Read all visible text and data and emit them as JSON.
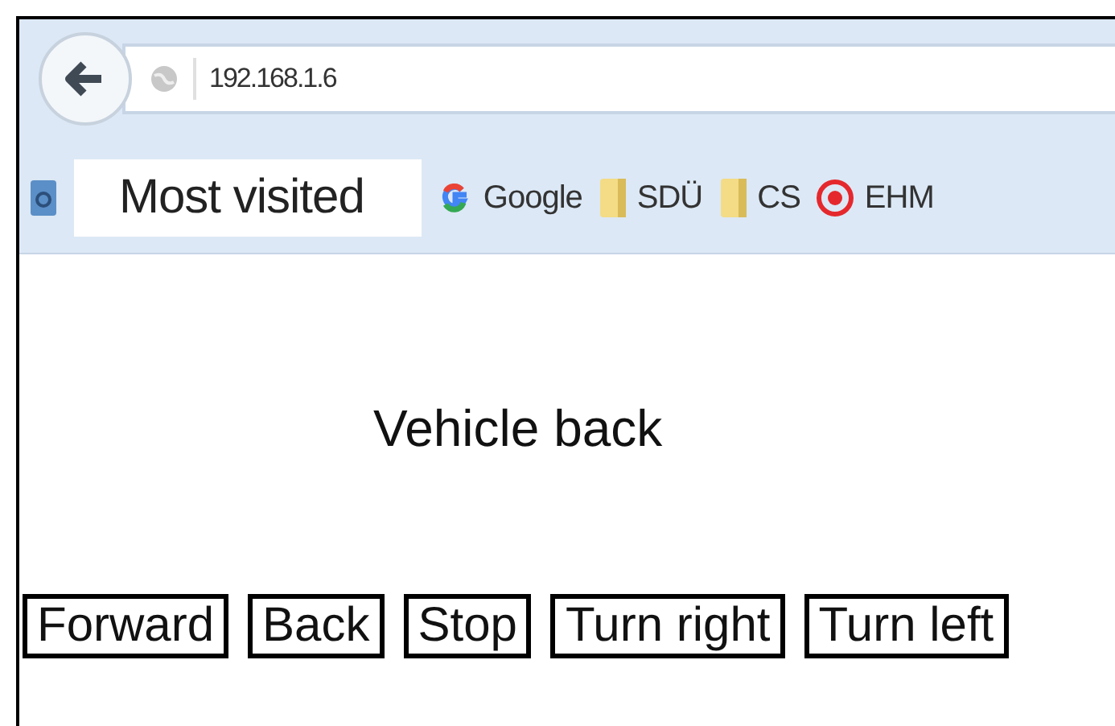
{
  "address_bar": {
    "url": "192.168.1.6"
  },
  "bookmarks": [
    {
      "label": "Most visited",
      "kind": "highlighted"
    },
    {
      "label": "Google",
      "kind": "google"
    },
    {
      "label": "SDÜ",
      "kind": "folder"
    },
    {
      "label": "CS",
      "kind": "folder"
    },
    {
      "label": "EHM",
      "kind": "target"
    }
  ],
  "page": {
    "status": "Vehicle back",
    "buttons": [
      "Forward",
      "Back",
      "Stop",
      "Turn right",
      "Turn left"
    ]
  }
}
